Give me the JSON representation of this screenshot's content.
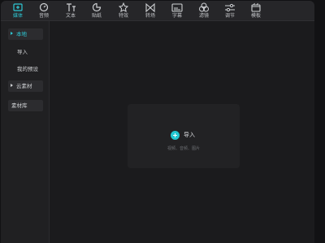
{
  "toolbar": {
    "items": [
      {
        "label": "媒体",
        "icon": "media-icon",
        "active": true
      },
      {
        "label": "音频",
        "icon": "audio-icon"
      },
      {
        "label": "文本",
        "icon": "text-icon"
      },
      {
        "label": "贴纸",
        "icon": "sticker-icon"
      },
      {
        "label": "特效",
        "icon": "effects-icon"
      },
      {
        "label": "转场",
        "icon": "transition-icon"
      },
      {
        "label": "字幕",
        "icon": "subtitle-icon"
      },
      {
        "label": "滤镜",
        "icon": "filter-icon"
      },
      {
        "label": "调节",
        "icon": "adjust-icon"
      },
      {
        "label": "模板",
        "icon": "template-icon"
      }
    ],
    "accent_color": "#2ec8d4"
  },
  "sidebar": {
    "local": "本地",
    "import": "导入",
    "my_presets": "我的预设",
    "cloud_assets": "云素材",
    "asset_library": "素材库"
  },
  "main": {
    "import_label": "导入",
    "import_hint": "视频、音频、图片",
    "plus_icon": "plus-circle-icon"
  }
}
